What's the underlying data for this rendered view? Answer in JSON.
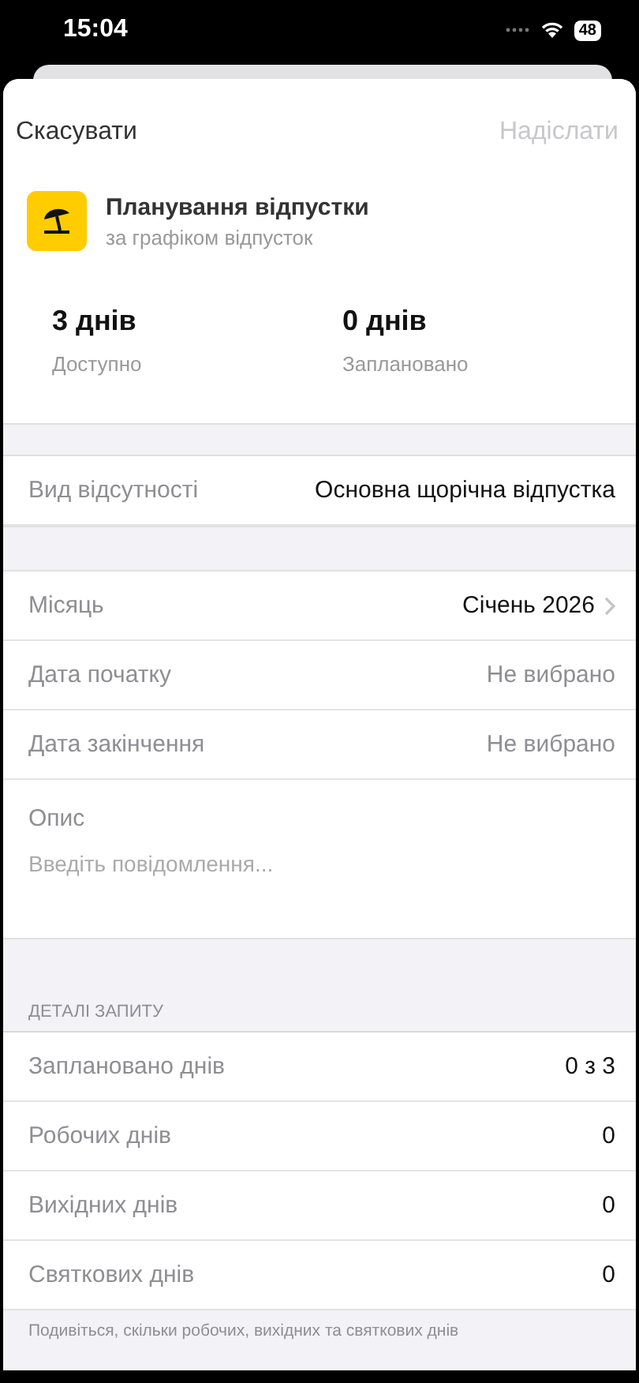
{
  "status_bar": {
    "time": "15:04",
    "battery": "48"
  },
  "nav": {
    "cancel": "Скасувати",
    "submit": {
      "label": "Надіслати",
      "disabled": true
    }
  },
  "header": {
    "title": "Планування відпустки",
    "subtitle": "за графіком відпусток"
  },
  "stats": [
    {
      "value": "3 днів",
      "label": "Доступно"
    },
    {
      "value": "0 днів",
      "label": "Заплановано"
    }
  ],
  "absence_type": {
    "label": "Вид відсутності",
    "value": "Основна щорічна відпустка"
  },
  "form_rows": [
    {
      "kind": "select",
      "label": "Місяць",
      "value": "Січень 2026",
      "placeholder_style": false
    },
    {
      "kind": "value",
      "label": "Дата початку",
      "value": "Не вибрано",
      "placeholder_style": true
    },
    {
      "kind": "value",
      "label": "Дата закінчення",
      "value": "Не вибрано",
      "placeholder_style": true
    }
  ],
  "description": {
    "label": "Опис",
    "placeholder": "Введіть повідомлення..."
  },
  "details": {
    "heading": "ДЕТАЛІ ЗАПИТУ",
    "rows": [
      {
        "label": "Заплановано днів",
        "value": "0 з 3"
      },
      {
        "label": "Робочих днів",
        "value": "0"
      },
      {
        "label": "Вихідних днів",
        "value": "0"
      },
      {
        "label": "Святкових днів",
        "value": "0"
      }
    ],
    "footer": "Подивіться, скільки робочих, вихідних та святкових днів"
  }
}
